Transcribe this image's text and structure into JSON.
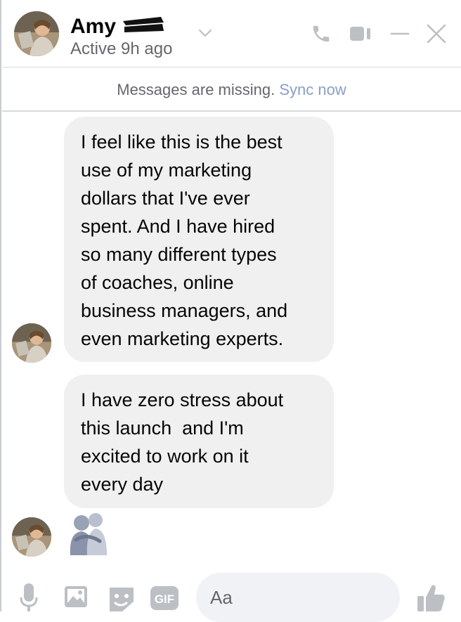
{
  "header": {
    "name": "Amy",
    "status": "Active 9h ago"
  },
  "banner": {
    "text": "Messages are missing.",
    "action": "Sync now"
  },
  "messages": [
    {
      "lines": [
        "I feel like this is the best",
        "use of my marketing",
        "dollars that I've ever",
        "spent. And I have hired",
        "so many different types",
        "of coaches, online",
        "business managers, and",
        "even marketing experts."
      ]
    },
    {
      "lines": [
        "I have zero stress about",
        "this launch  and I'm",
        "excited to work on it",
        "every day"
      ]
    }
  ],
  "sticker": "hug-sticker",
  "composer": {
    "placeholder": "Aa"
  },
  "colors": {
    "icon": "#bcc0c4",
    "muted_text": "#65676b",
    "sync_link": "#8a9fc7",
    "bubble_bg": "#f0f0f0"
  }
}
